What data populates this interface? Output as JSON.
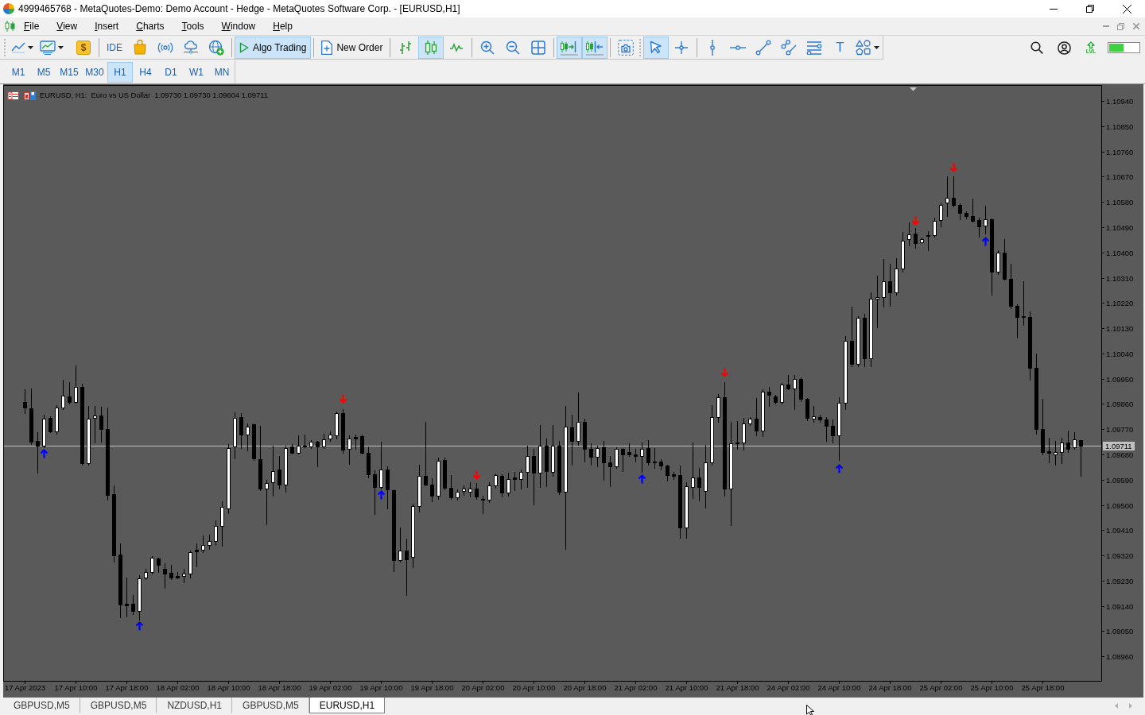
{
  "window": {
    "title": "4999465768 - MetaQuotes-Demo: Demo Account - Hedge - MetaQuotes Software Corp. - [EURUSD,H1]"
  },
  "menu": [
    "File",
    "View",
    "Insert",
    "Charts",
    "Tools",
    "Window",
    "Help"
  ],
  "toolbar": {
    "dollar_button": "$",
    "ide_button": "IDE",
    "algo_trading": {
      "label": "Algo Trading",
      "on": true
    },
    "new_order": "New Order",
    "chart_types": [
      {
        "selected": false
      },
      {
        "selected": true
      },
      {
        "selected": false
      }
    ],
    "chart_scrolling": [
      {
        "on": true
      },
      {
        "on": true
      }
    ],
    "pointer_tools": [
      {
        "selected": true
      },
      {
        "selected": false
      }
    ],
    "text_tool": "T",
    "level_badge": "LVL"
  },
  "timeframes": [
    {
      "label": "M1",
      "selected": false
    },
    {
      "label": "M5",
      "selected": false
    },
    {
      "label": "M15",
      "selected": false
    },
    {
      "label": "M30",
      "selected": false
    },
    {
      "label": "H1",
      "selected": true
    },
    {
      "label": "H4",
      "selected": false
    },
    {
      "label": "D1",
      "selected": false
    },
    {
      "label": "W1",
      "selected": false
    },
    {
      "label": "MN",
      "selected": false
    }
  ],
  "chart": {
    "chart_data": [
      {
        "type": "candlestick",
        "title": "EURUSD, H1:  Euro vs US Dollar  1.09730 1.09730 1.09604 1.09711",
        "categories": [
          "17 Apr 2023",
          null,
          null,
          null,
          null,
          null,
          null,
          null,
          "17 Apr 10:00",
          null,
          null,
          null,
          null,
          null,
          null,
          null,
          "17 Apr 18:00",
          null,
          null,
          null,
          null,
          null,
          null,
          null,
          "18 Apr 02:00",
          null,
          null,
          null,
          null,
          null,
          null,
          null,
          "18 Apr 10:00",
          null,
          null,
          null,
          null,
          null,
          null,
          null,
          "18 Apr 18:00",
          null,
          null,
          null,
          null,
          null,
          null,
          null,
          "19 Apr 02:00",
          null,
          null,
          null,
          null,
          null,
          null,
          null,
          "19 Apr 10:00",
          null,
          null,
          null,
          null,
          null,
          null,
          null,
          "19 Apr 18:00",
          null,
          null,
          null,
          null,
          null,
          null,
          null,
          "20 Apr 02:00",
          null,
          null,
          null,
          null,
          null,
          null,
          null,
          "20 Apr 10:00",
          null,
          null,
          null,
          null,
          null,
          null,
          null,
          "20 Apr 18:00",
          null,
          null,
          null,
          null,
          null,
          null,
          null,
          "21 Apr 02:00",
          null,
          null,
          null,
          null,
          null,
          null,
          null,
          "21 Apr 10:00",
          null,
          null,
          null,
          null,
          null,
          null,
          null,
          "21 Apr 18:00",
          null,
          null,
          null,
          null,
          null,
          null,
          null,
          "24 Apr 02:00",
          null,
          null,
          null,
          null,
          null,
          null,
          null,
          "24 Apr 10:00",
          null,
          null,
          null,
          null,
          null,
          null,
          null,
          "24 Apr 18:00",
          null,
          null,
          null,
          null,
          null,
          null,
          null,
          "25 Apr 02:00",
          null,
          null,
          null,
          null,
          null,
          null,
          null,
          "25 Apr 10:00",
          null,
          null,
          null,
          null,
          null,
          null,
          null,
          "25 Apr 18:00",
          null,
          null,
          null,
          null,
          null,
          null
        ],
        "ohlc": [
          [
            1.09868,
            1.09911,
            1.09826,
            1.09848
          ],
          [
            1.09845,
            1.09916,
            1.09718,
            1.09726
          ],
          [
            1.09729,
            1.0976,
            1.09616,
            1.09712
          ],
          [
            1.09712,
            1.09823,
            1.09706,
            1.09808
          ],
          [
            1.09811,
            1.09817,
            1.0976,
            1.09763
          ],
          [
            1.09763,
            1.09857,
            1.09755,
            1.09848
          ],
          [
            1.09848,
            1.09945,
            1.09842,
            1.09891
          ],
          [
            1.09888,
            1.09939,
            1.09862,
            1.09868
          ],
          [
            1.09868,
            1.09998,
            1.09865,
            1.09922
          ],
          [
            1.09922,
            1.09933,
            1.09644,
            1.0965
          ],
          [
            1.0965,
            1.09854,
            1.09644,
            1.09808
          ],
          [
            1.09811,
            1.09854,
            1.09723,
            1.0982
          ],
          [
            1.0982,
            1.09851,
            1.09726,
            1.09772
          ],
          [
            1.09772,
            1.09848,
            1.09519,
            1.09536
          ],
          [
            1.09539,
            1.0957,
            1.09298,
            1.09321
          ],
          [
            1.09324,
            1.09363,
            1.091,
            1.09145
          ],
          [
            1.09148,
            1.09241,
            1.09102,
            1.09142
          ],
          [
            1.09148,
            1.09179,
            1.09111,
            1.09122
          ],
          [
            1.09122,
            1.0925,
            1.09091,
            1.09238
          ],
          [
            1.09241,
            1.09273,
            1.09235,
            1.09261
          ],
          [
            1.09261,
            1.09318,
            1.09255,
            1.09312
          ],
          [
            1.09309,
            1.09312,
            1.09261,
            1.09287
          ],
          [
            1.09273,
            1.09292,
            1.09204,
            1.09255
          ],
          [
            1.09258,
            1.09287,
            1.09235,
            1.09241
          ],
          [
            1.09247,
            1.09261,
            1.09238,
            1.09241
          ],
          [
            1.09247,
            1.09273,
            1.09224,
            1.09255
          ],
          [
            1.09255,
            1.09338,
            1.09241,
            1.09332
          ],
          [
            1.09341,
            1.09363,
            1.09281,
            1.09335
          ],
          [
            1.09341,
            1.09392,
            1.09332,
            1.09358
          ],
          [
            1.09358,
            1.09395,
            1.09344,
            1.09372
          ],
          [
            1.09372,
            1.09445,
            1.09358,
            1.09426
          ],
          [
            1.09426,
            1.09514,
            1.09355,
            1.09494
          ],
          [
            1.09488,
            1.09718,
            1.09471,
            1.09704
          ],
          [
            1.09709,
            1.09831,
            1.09667,
            1.09811
          ],
          [
            1.09814,
            1.09828,
            1.09704,
            1.09752
          ],
          [
            1.09752,
            1.09791,
            1.09694,
            1.0978
          ],
          [
            1.09789,
            1.09791,
            1.09661,
            1.09667
          ],
          [
            1.09664,
            1.09783,
            1.09553,
            1.09559
          ],
          [
            1.09559,
            1.0959,
            1.09431,
            1.09579
          ],
          [
            1.09582,
            1.09712,
            1.09533,
            1.09621
          ],
          [
            1.09627,
            1.09675,
            1.09559,
            1.09573
          ],
          [
            1.09573,
            1.09712,
            1.09548,
            1.09704
          ],
          [
            1.09709,
            1.09718,
            1.09684,
            1.09687
          ],
          [
            1.09687,
            1.09749,
            1.09684,
            1.09712
          ],
          [
            1.09712,
            1.09752,
            1.09706,
            1.09709
          ],
          [
            1.09709,
            1.09732,
            1.09704,
            1.09726
          ],
          [
            1.09726,
            1.09729,
            1.09638,
            1.09709
          ],
          [
            1.09709,
            1.09755,
            1.09704,
            1.09735
          ],
          [
            1.09738,
            1.09763,
            1.09729,
            1.09752
          ],
          [
            1.09749,
            1.09834,
            1.09738,
            1.09828
          ],
          [
            1.09828,
            1.09842,
            1.09687,
            1.09697
          ],
          [
            1.097,
            1.09749,
            1.09647,
            1.09738
          ],
          [
            1.09743,
            1.09752,
            1.09701,
            1.09738
          ],
          [
            1.09746,
            1.09752,
            1.09684,
            1.09687
          ],
          [
            1.09687,
            1.09709,
            1.09599,
            1.0961
          ],
          [
            1.0961,
            1.09624,
            1.09468,
            1.09565
          ],
          [
            1.09565,
            1.09726,
            1.09559,
            1.09627
          ],
          [
            1.09627,
            1.09638,
            1.09488,
            1.09556
          ],
          [
            1.09553,
            1.09556,
            1.09264,
            1.09304
          ],
          [
            1.09304,
            1.0942,
            1.09298,
            1.09338
          ],
          [
            1.09338,
            1.0938,
            1.09179,
            1.09306
          ],
          [
            1.09315,
            1.09505,
            1.09278,
            1.09497
          ],
          [
            1.09497,
            1.09644,
            1.09477,
            1.09604
          ],
          [
            1.09604,
            1.09797,
            1.0957,
            1.09573
          ],
          [
            1.09573,
            1.09596,
            1.09514,
            1.09533
          ],
          [
            1.09533,
            1.0967,
            1.09522,
            1.09658
          ],
          [
            1.09661,
            1.0967,
            1.09556,
            1.09562
          ],
          [
            1.09562,
            1.09607,
            1.09522,
            1.09528
          ],
          [
            1.09528,
            1.09556,
            1.09519,
            1.09548
          ],
          [
            1.0955,
            1.0957,
            1.09536,
            1.09559
          ],
          [
            1.09548,
            1.09582,
            1.09531,
            1.09559
          ],
          [
            1.09559,
            1.09579,
            1.09522,
            1.09531
          ],
          [
            1.09522,
            1.09533,
            1.09471,
            1.09519
          ],
          [
            1.09519,
            1.09582,
            1.09511,
            1.0957
          ],
          [
            1.0957,
            1.09613,
            1.09562,
            1.09607
          ],
          [
            1.09604,
            1.0961,
            1.09531,
            1.09545
          ],
          [
            1.09545,
            1.09616,
            1.09533,
            1.09593
          ],
          [
            1.09599,
            1.09618,
            1.09553,
            1.09593
          ],
          [
            1.09593,
            1.09627,
            1.09559,
            1.09618
          ],
          [
            1.09618,
            1.09712,
            1.09565,
            1.09675
          ],
          [
            1.09675,
            1.09701,
            1.09502,
            1.09616
          ],
          [
            1.09616,
            1.09786,
            1.09565,
            1.09712
          ],
          [
            1.09712,
            1.09738,
            1.09567,
            1.09621
          ],
          [
            1.09618,
            1.09786,
            1.09604,
            1.09712
          ],
          [
            1.09712,
            1.09729,
            1.09539,
            1.09548
          ],
          [
            1.09548,
            1.09854,
            1.09344,
            1.0978
          ],
          [
            1.09777,
            1.09823,
            1.09644,
            1.09729
          ],
          [
            1.09729,
            1.09902,
            1.09715,
            1.09797
          ],
          [
            1.09797,
            1.09808,
            1.09655,
            1.097
          ],
          [
            1.097,
            1.09721,
            1.09644,
            1.09672
          ],
          [
            1.09672,
            1.09712,
            1.09638,
            1.09704
          ],
          [
            1.09706,
            1.09729,
            1.0959,
            1.09653
          ],
          [
            1.09653,
            1.09675,
            1.09567,
            1.09638
          ],
          [
            1.09638,
            1.09706,
            1.09633,
            1.097
          ],
          [
            1.097,
            1.09704,
            1.09621,
            1.09681
          ],
          [
            1.09689,
            1.09721,
            1.09675,
            1.09681
          ],
          [
            1.09681,
            1.09701,
            1.09655,
            1.09675
          ],
          [
            1.09675,
            1.09723,
            1.09618,
            1.09701
          ],
          [
            1.09704,
            1.09732,
            1.09644,
            1.09653
          ],
          [
            1.09655,
            1.09704,
            1.09633,
            1.09653
          ],
          [
            1.09655,
            1.09664,
            1.09627,
            1.09641
          ],
          [
            1.09641,
            1.09644,
            1.09587,
            1.09607
          ],
          [
            1.0961,
            1.09618,
            1.09593,
            1.09604
          ],
          [
            1.09607,
            1.09641,
            1.09383,
            1.0942
          ],
          [
            1.0942,
            1.09582,
            1.09383,
            1.09567
          ],
          [
            1.09565,
            1.09723,
            1.09525,
            1.09599
          ],
          [
            1.09599,
            1.09633,
            1.09516,
            1.09565
          ],
          [
            1.0955,
            1.09715,
            1.09491,
            1.09653
          ],
          [
            1.09653,
            1.09857,
            1.09644,
            1.09814
          ],
          [
            1.09814,
            1.09896,
            1.09797,
            1.09885
          ],
          [
            1.09885,
            1.09939,
            1.09533,
            1.09559
          ],
          [
            1.09559,
            1.09797,
            1.09428,
            1.09721
          ],
          [
            1.09723,
            1.098,
            1.09701,
            1.09721
          ],
          [
            1.09723,
            1.09811,
            1.09697,
            1.09791
          ],
          [
            1.09791,
            1.09814,
            1.09786,
            1.09808
          ],
          [
            1.09808,
            1.09882,
            1.09749,
            1.09766
          ],
          [
            1.09766,
            1.09911,
            1.09746,
            1.09905
          ],
          [
            1.09905,
            1.09922,
            1.09854,
            1.09893
          ],
          [
            1.09888,
            1.09893,
            1.09862,
            1.09868
          ],
          [
            1.09868,
            1.09936,
            1.09862,
            1.09928
          ],
          [
            1.09928,
            1.09962,
            1.09911,
            1.09916
          ],
          [
            1.09916,
            1.09962,
            1.09842,
            1.0995
          ],
          [
            1.0995,
            1.09956,
            1.09871,
            1.09877
          ],
          [
            1.09877,
            1.09882,
            1.09803,
            1.09811
          ],
          [
            1.09808,
            1.09854,
            1.09797,
            1.09817
          ],
          [
            1.09814,
            1.09823,
            1.09797,
            1.09806
          ],
          [
            1.09806,
            1.09814,
            1.09729,
            1.09783
          ],
          [
            1.09783,
            1.09806,
            1.09723,
            1.09749
          ],
          [
            1.09749,
            1.09885,
            1.09661,
            1.09865
          ],
          [
            1.09865,
            1.10101,
            1.09842,
            1.10084
          ],
          [
            1.10084,
            1.10206,
            1.09995,
            1.10004
          ],
          [
            1.10004,
            1.10174,
            1.09993,
            1.10166
          ],
          [
            1.10166,
            1.1018,
            1.09993,
            1.10024
          ],
          [
            1.10024,
            1.10259,
            1.09995,
            1.10234
          ],
          [
            1.10234,
            1.10316,
            1.10132,
            1.10242
          ],
          [
            1.10242,
            1.10376,
            1.10206,
            1.10296
          ],
          [
            1.10296,
            1.10359,
            1.10209,
            1.10259
          ],
          [
            1.10259,
            1.10379,
            1.10248,
            1.10342
          ],
          [
            1.10342,
            1.10472,
            1.1033,
            1.10441
          ],
          [
            1.10447,
            1.10506,
            1.10424,
            1.10464
          ],
          [
            1.10467,
            1.10486,
            1.10415,
            1.10432
          ],
          [
            1.10435,
            1.10452,
            1.10432,
            1.10447
          ],
          [
            1.10461,
            1.10475,
            1.10407,
            1.10458
          ],
          [
            1.10461,
            1.10523,
            1.10455,
            1.10512
          ],
          [
            1.10515,
            1.10577,
            1.10492,
            1.10569
          ],
          [
            1.10577,
            1.10671,
            1.10529,
            1.10594
          ],
          [
            1.10594,
            1.10671,
            1.10563,
            1.10569
          ],
          [
            1.10569,
            1.10574,
            1.10517,
            1.1054
          ],
          [
            1.1054,
            1.10546,
            1.1052,
            1.10529
          ],
          [
            1.10529,
            1.10591,
            1.10509,
            1.10512
          ],
          [
            1.10515,
            1.10523,
            1.10455,
            1.10492
          ],
          [
            1.10495,
            1.10566,
            1.10467,
            1.10517
          ],
          [
            1.10517,
            1.1052,
            1.10248,
            1.1033
          ],
          [
            1.1033,
            1.10407,
            1.10322,
            1.10398
          ],
          [
            1.10398,
            1.10447,
            1.10302,
            1.10305
          ],
          [
            1.10305,
            1.10361,
            1.102,
            1.10209
          ],
          [
            1.10209,
            1.10214,
            1.10095,
            1.10171
          ],
          [
            1.10174,
            1.10296,
            1.10143,
            1.10169
          ],
          [
            1.10171,
            1.10189,
            1.09945,
            1.0999
          ],
          [
            1.0999,
            1.10041,
            1.09755,
            1.09772
          ],
          [
            1.09772,
            1.09877,
            1.09681,
            1.09689
          ],
          [
            1.09692,
            1.0974,
            1.09653,
            1.09687
          ],
          [
            1.09681,
            1.09729,
            1.09644,
            1.09689
          ],
          [
            1.09689,
            1.0974,
            1.0965,
            1.09723
          ],
          [
            1.09723,
            1.09766,
            1.09689,
            1.097
          ],
          [
            1.09706,
            1.09758,
            1.09701,
            1.09735
          ],
          [
            1.0973,
            1.0973,
            1.09604,
            1.09711
          ]
        ],
        "series": [
          {
            "type": "scatter",
            "color": "#0000ff",
            "values": [
              null,
              null,
              null,
              1.09684,
              null,
              null,
              null,
              null,
              null,
              null,
              null,
              null,
              null,
              null,
              null,
              null,
              null,
              null,
              1.09068,
              null,
              null,
              null,
              null,
              null,
              null,
              null,
              null,
              null,
              null,
              null,
              null,
              null,
              null,
              null,
              null,
              null,
              null,
              null,
              null,
              null,
              null,
              null,
              null,
              null,
              null,
              null,
              null,
              null,
              null,
              null,
              null,
              null,
              null,
              null,
              null,
              null,
              1.09536,
              null,
              null,
              null,
              null,
              null,
              null,
              null,
              null,
              null,
              null,
              null,
              null,
              null,
              null,
              null,
              null,
              null,
              null,
              null,
              null,
              null,
              null,
              null,
              null,
              null,
              null,
              null,
              null,
              null,
              null,
              null,
              null,
              null,
              null,
              null,
              null,
              null,
              null,
              null,
              null,
              1.09593,
              null,
              null,
              null,
              null,
              null,
              null,
              null,
              null,
              null,
              null,
              null,
              null,
              null,
              null,
              null,
              null,
              null,
              null,
              null,
              null,
              null,
              null,
              null,
              null,
              null,
              null,
              null,
              null,
              null,
              null,
              1.0963,
              null,
              null,
              null,
              null,
              null,
              null,
              null,
              null,
              null,
              null,
              null,
              null,
              null,
              null,
              null,
              null,
              null,
              null,
              null,
              null,
              null,
              null,
              1.10438,
              null,
              null,
              null,
              null,
              null,
              null,
              null,
              null,
              null,
              null,
              null,
              null,
              null,
              null,
              null
            ]
          },
          {
            "type": "scatter",
            "color": "#ff0000",
            "values": [
              null,
              null,
              null,
              null,
              null,
              null,
              null,
              null,
              null,
              null,
              null,
              null,
              null,
              null,
              null,
              null,
              null,
              null,
              null,
              null,
              null,
              null,
              null,
              null,
              null,
              null,
              null,
              null,
              null,
              null,
              null,
              null,
              null,
              null,
              null,
              null,
              null,
              null,
              null,
              null,
              null,
              null,
              null,
              null,
              null,
              null,
              null,
              null,
              null,
              null,
              1.09877,
              null,
              null,
              null,
              null,
              null,
              null,
              null,
              null,
              null,
              null,
              null,
              null,
              null,
              null,
              null,
              null,
              null,
              null,
              null,
              null,
              1.09607,
              null,
              null,
              null,
              null,
              null,
              null,
              null,
              null,
              null,
              null,
              null,
              null,
              null,
              null,
              null,
              null,
              null,
              null,
              null,
              null,
              null,
              null,
              null,
              null,
              null,
              null,
              null,
              null,
              null,
              null,
              null,
              null,
              null,
              null,
              null,
              null,
              null,
              null,
              1.09973,
              null,
              null,
              null,
              null,
              null,
              null,
              null,
              null,
              null,
              null,
              null,
              null,
              null,
              null,
              null,
              null,
              null,
              null,
              null,
              null,
              null,
              null,
              null,
              null,
              null,
              null,
              null,
              null,
              null,
              1.10512,
              null,
              null,
              null,
              null,
              null,
              1.10702,
              null,
              null,
              null,
              null,
              null,
              null,
              null,
              null,
              null,
              null,
              null,
              null,
              null,
              null,
              null,
              null,
              null,
              null,
              null,
              null
            ]
          }
        ],
        "ylim": [
          1.08873,
          1.10994
        ],
        "yticks": [
          {
            "value": 1.1094,
            "label": "1.10940"
          },
          {
            "value": 1.1085,
            "label": "1.10850"
          },
          {
            "value": 1.1076,
            "label": "1.10760"
          },
          {
            "value": 1.1067,
            "label": "1.10670"
          },
          {
            "value": 1.1058,
            "label": "1.10580"
          },
          {
            "value": 1.1049,
            "label": "1.10490"
          },
          {
            "value": 1.104,
            "label": "1.10400"
          },
          {
            "value": 1.1031,
            "label": "1.10310"
          },
          {
            "value": 1.1022,
            "label": "1.10220"
          },
          {
            "value": 1.1013,
            "label": "1.10130"
          },
          {
            "value": 1.1004,
            "label": "1.10040"
          },
          {
            "value": 1.0995,
            "label": "1.09950"
          },
          {
            "value": 1.0986,
            "label": "1.09860"
          },
          {
            "value": 1.0977,
            "label": "1.09770"
          },
          {
            "value": 1.0968,
            "label": "1.09680"
          },
          {
            "value": 1.0959,
            "label": "1.09590"
          },
          {
            "value": 1.095,
            "label": "1.09500"
          },
          {
            "value": 1.0941,
            "label": "1.09410"
          },
          {
            "value": 1.0932,
            "label": "1.09320"
          },
          {
            "value": 1.0923,
            "label": "1.09230"
          },
          {
            "value": 1.0914,
            "label": "1.09140"
          },
          {
            "value": 1.0905,
            "label": "1.09050"
          },
          {
            "value": 1.0896,
            "label": "1.08960"
          }
        ],
        "ref_lines": [
          {
            "axis": "y",
            "value": 1.09711,
            "label": "1.09711",
            "color": "#c0c0c0"
          }
        ]
      }
    ]
  },
  "chart_tabs": [
    {
      "label": "GBPUSD,M5",
      "selected": false
    },
    {
      "label": "GBPUSD,M5",
      "selected": false
    },
    {
      "label": "NZDUSD,H1",
      "selected": false
    },
    {
      "label": "GBPUSD,M5",
      "selected": false
    },
    {
      "label": "EURUSD,H1",
      "selected": true
    }
  ]
}
